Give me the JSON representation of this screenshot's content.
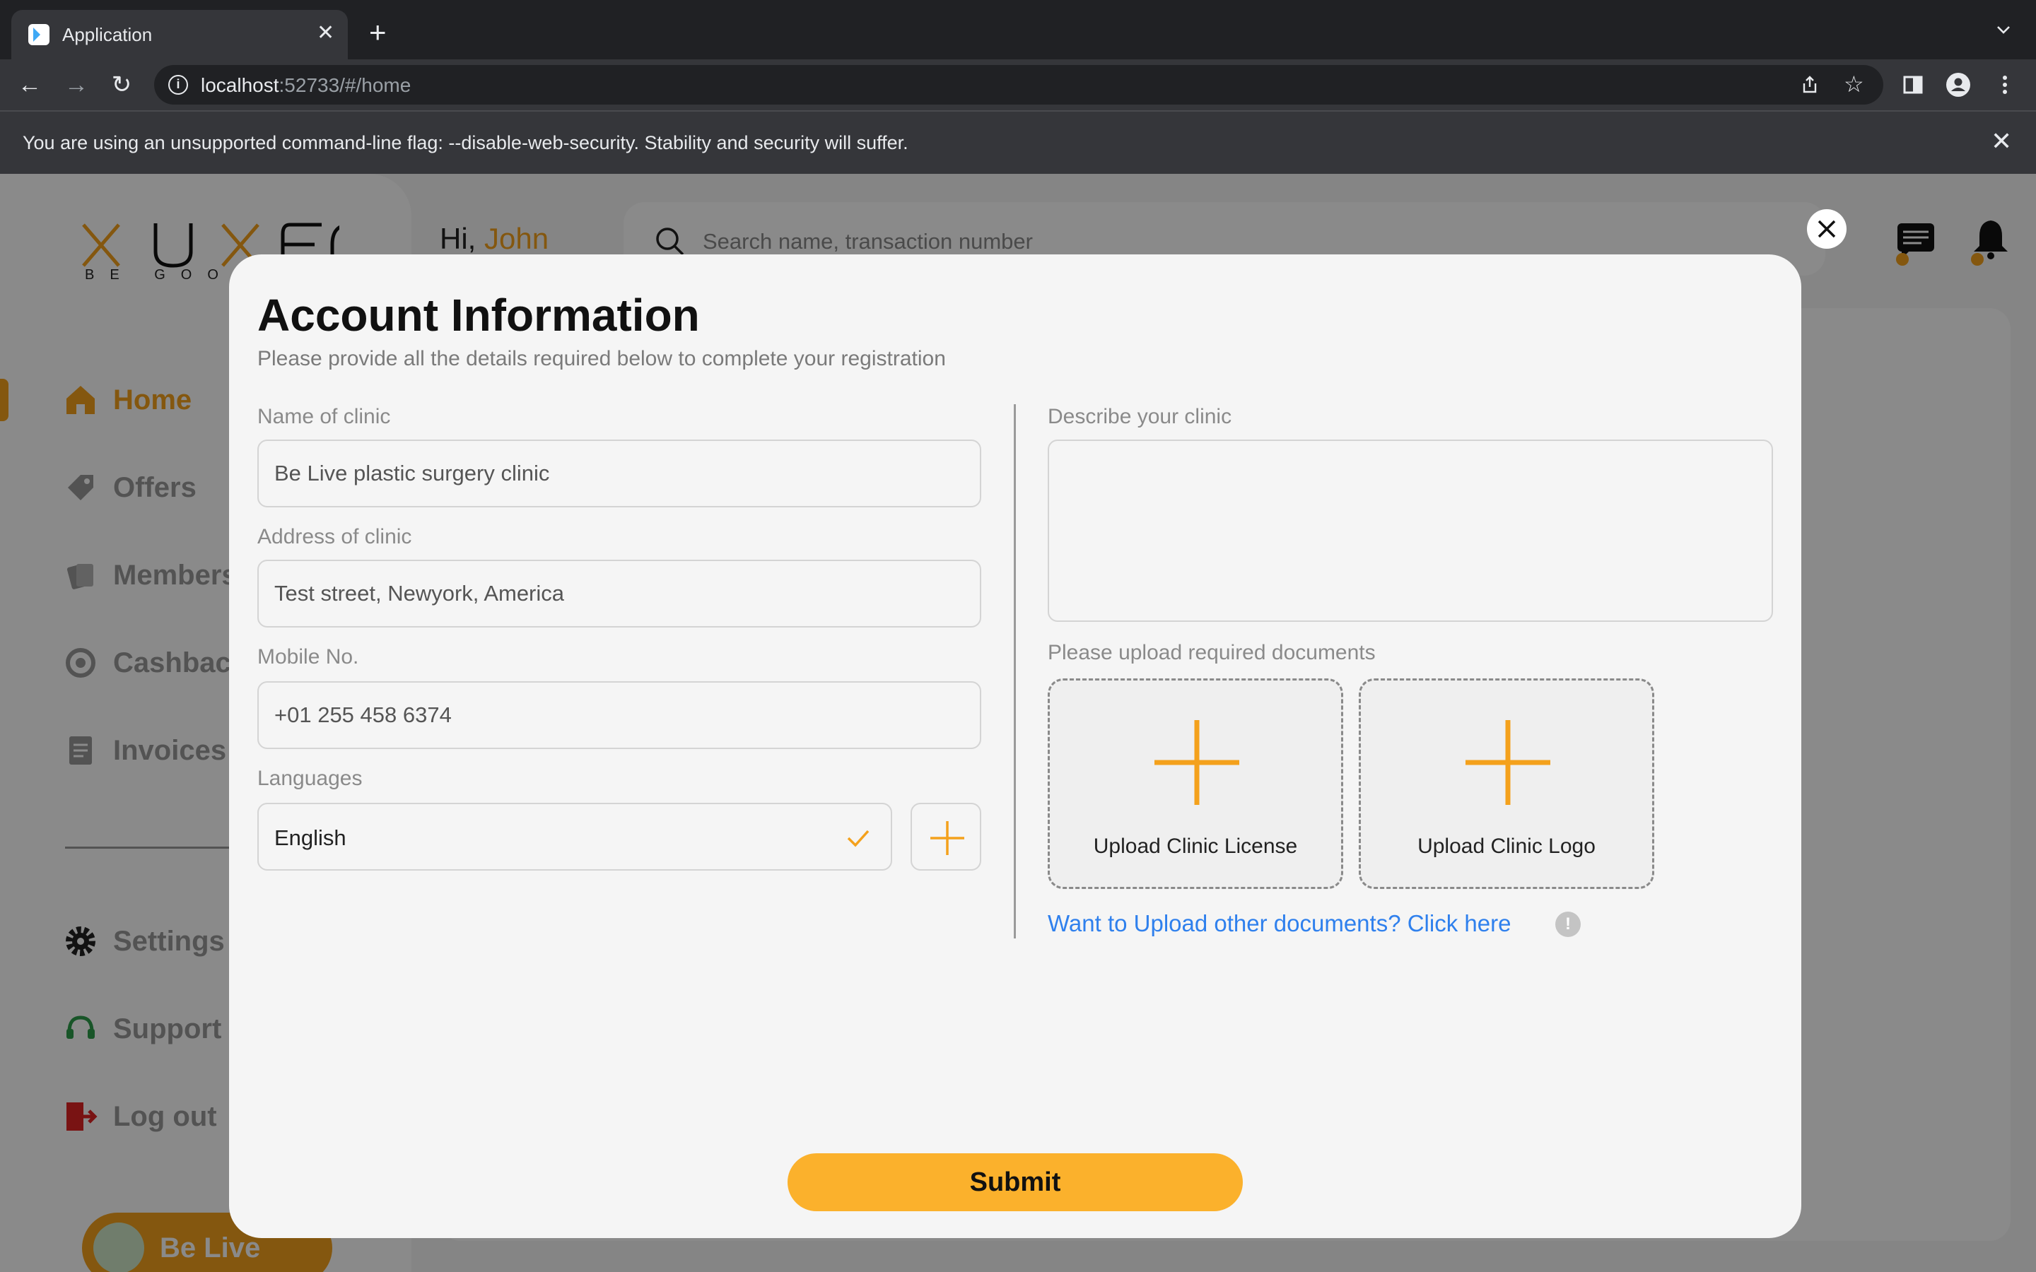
{
  "browser": {
    "tab_title": "Application",
    "url_host": "localhost",
    "url_rest": ":52733/#/home",
    "infobar_message": "You are using an unsupported command-line flag: --disable-web-security. Stability and security will suffer."
  },
  "app": {
    "logo_tagline": "BE GOOD",
    "greeting_prefix": "Hi, ",
    "user_name": "John",
    "search_placeholder": "Search name, transaction number",
    "sidebar": {
      "items": [
        {
          "label": "Home",
          "icon": "home-icon",
          "active": true
        },
        {
          "label": "Offers",
          "icon": "tag-icon"
        },
        {
          "label": "Members",
          "icon": "members-icon"
        },
        {
          "label": "Cashback",
          "icon": "cashback-icon"
        },
        {
          "label": "Invoices",
          "icon": "invoice-icon"
        },
        {
          "label": "Settings",
          "icon": "gear-icon"
        },
        {
          "label": "Support",
          "icon": "headset-icon"
        },
        {
          "label": "Log out",
          "icon": "logout-icon"
        }
      ]
    },
    "profile_pill": "Be Live",
    "colors": {
      "accent": "#f4a11c",
      "link": "#2f80ed",
      "submit": "#fbb12c"
    }
  },
  "modal": {
    "title": "Account Information",
    "subtitle": "Please provide all the details required below to complete your registration",
    "fields": {
      "clinic_name": {
        "label": "Name of clinic",
        "value": "Be Live plastic surgery clinic"
      },
      "clinic_address": {
        "label": "Address of clinic",
        "value": "Test street, Newyork, America"
      },
      "mobile": {
        "label": "Mobile No.",
        "value": "+01 255 458 6374"
      },
      "languages": {
        "label": "Languages",
        "value": "English"
      },
      "description": {
        "label": "Describe your clinic",
        "value": ""
      }
    },
    "uploads": {
      "label": "Please upload required documents",
      "license": "Upload Clinic License",
      "logo": "Upload Clinic Logo"
    },
    "other_docs_link": "Want to Upload other documents? Click here",
    "info_badge": "!",
    "submit_label": "Submit"
  }
}
